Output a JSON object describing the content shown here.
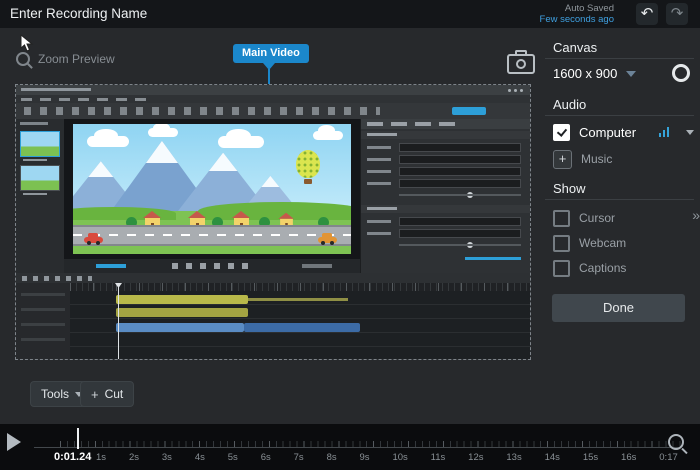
{
  "header": {
    "title": "Enter Recording Name",
    "autosave": {
      "label": "Auto Saved",
      "time": "Few seconds ago"
    }
  },
  "icons": {
    "undo": "↶",
    "redo": "↷",
    "plus": "+",
    "double_chevron": "»"
  },
  "preview": {
    "zoom_label": "Zoom Preview",
    "badge": "Main Video"
  },
  "sidebar": {
    "canvas": {
      "heading": "Canvas",
      "size": "1600 x 900"
    },
    "audio": {
      "heading": "Audio",
      "computer": "Computer",
      "music": "Music"
    },
    "show": {
      "heading": "Show",
      "cursor": "Cursor",
      "webcam": "Webcam",
      "captions": "Captions"
    },
    "done": "Done"
  },
  "tools": {
    "tools_label": "Tools",
    "cut_label": "Cut"
  },
  "timeline": {
    "current_time": "0:01.24",
    "ticks": [
      "1s",
      "2s",
      "3s",
      "4s",
      "5s",
      "6s",
      "7s",
      "8s",
      "9s",
      "10s",
      "11s",
      "12s",
      "13s",
      "14s",
      "15s",
      "16s",
      "0:17"
    ]
  },
  "colors": {
    "accent_blue": "#1b87cb",
    "autosave_blue": "#3f9fdf"
  }
}
